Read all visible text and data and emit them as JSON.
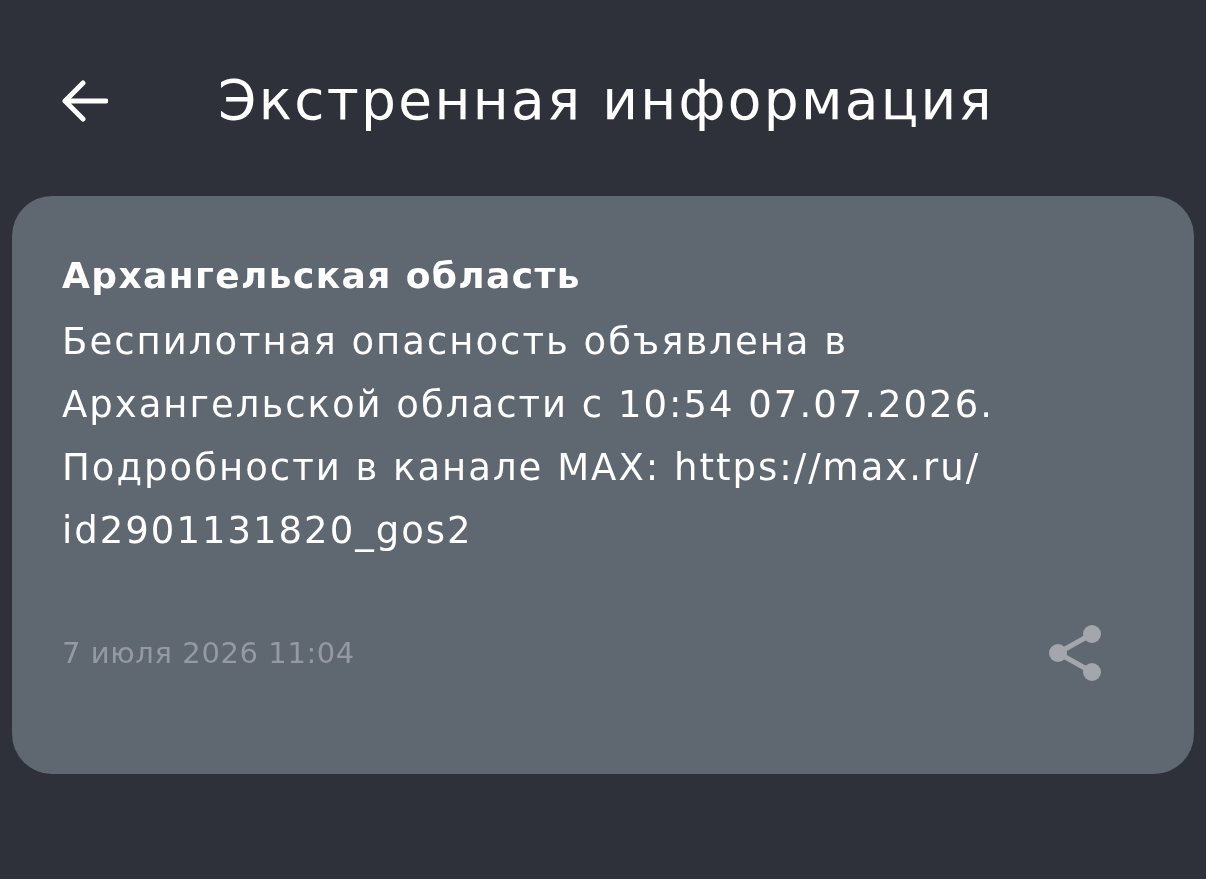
{
  "header": {
    "title": "Экстренная информация"
  },
  "alerts": [
    {
      "region": "Архангельская область",
      "message": "Беспилотная опасность объявлена в Архангельской области с 10:54 07.07.2026. Подробности в канале MAX: https://max.ru/id2901131820_gos2",
      "timestamp": "7 июля 2026 11:04"
    }
  ]
}
